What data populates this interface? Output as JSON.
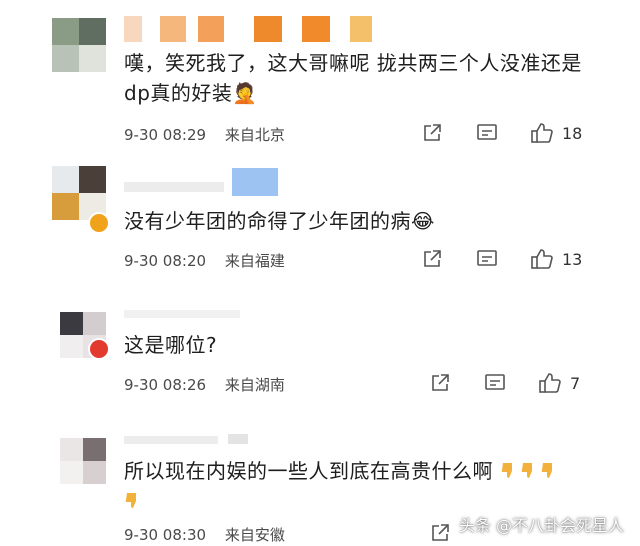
{
  "comments": [
    {
      "text": "嘆，笑死我了，这大哥嘛呢 拢共两三个人没准还是dp真的好装🤦",
      "date": "9-30 08:29",
      "location": "来自北京",
      "likes": "18"
    },
    {
      "text": "没有少年团的命得了少年团的病😂",
      "date": "9-30 08:20",
      "location": "来自福建",
      "likes": "13"
    },
    {
      "text": "这是哪位?",
      "date": "9-30 08:26",
      "location": "来自湖南",
      "likes": "7"
    },
    {
      "text": "所以现在内娱的一些人到底在高贵什么啊",
      "date": "9-30 08:30",
      "location": "来自安徽",
      "likes": ""
    }
  ],
  "icons": {
    "share": "share-icon",
    "comment": "comment-icon",
    "like": "thumbs-up-icon",
    "dislike_emoji": "thumbs-down-emoji"
  },
  "watermark": "头条 @不八卦会死星人",
  "colors": {
    "orange_name": "#f28a2a",
    "blue_name": "#8fb9ee",
    "badge_gold": "#f0a21a",
    "badge_red": "#e23a2e"
  }
}
